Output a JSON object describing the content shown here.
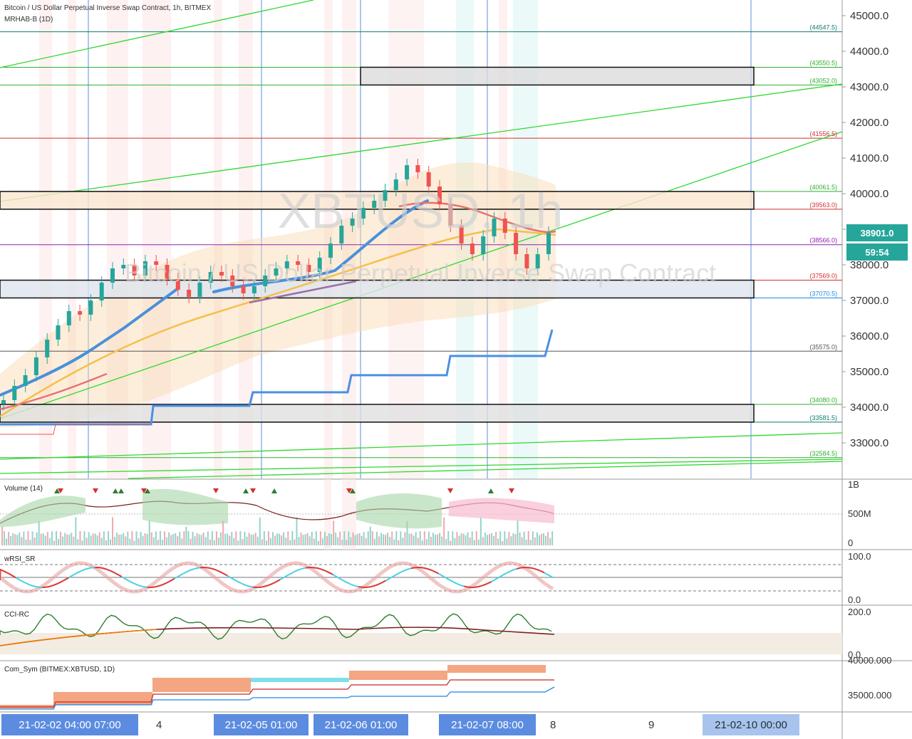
{
  "header": {
    "title": "Bitcoin / US Dollar Perpetual Inverse Swap Contract, 1h, BITMEX",
    "indicator": "MRHAB-B (1D)"
  },
  "watermark": {
    "symbol": "XBTUSD, 1h",
    "description": "Bitcoin / US Dollar Perpetual Inverse Swap Contract"
  },
  "price_axis": {
    "ticks": [
      "45000.0",
      "44000.0",
      "43000.0",
      "42000.0",
      "41000.0",
      "40000.0",
      "39000.0",
      "38000.0",
      "37000.0",
      "36000.0",
      "35000.0",
      "34000.0",
      "33000.0"
    ],
    "last_price": "38901.0",
    "countdown": "59:54",
    "last_price_color": "#26a69a"
  },
  "level_labels": [
    {
      "text": "(44547.5)",
      "color": "#137a6e"
    },
    {
      "text": "(43550.5)",
      "color": "#2fae2f"
    },
    {
      "text": "(43052.0)",
      "color": "#2fae2f"
    },
    {
      "text": "(41556.5)",
      "color": "#d12f2f"
    },
    {
      "text": "(40061.5)",
      "color": "#2fae2f"
    },
    {
      "text": "(39563.0)",
      "color": "#d12f2f"
    },
    {
      "text": "(38566.0)",
      "color": "#8e24aa"
    },
    {
      "text": "(37569.0)",
      "color": "#d12f2f"
    },
    {
      "text": "(37070.5)",
      "color": "#1e88e5"
    },
    {
      "text": "(35575.0)",
      "color": "#555555"
    },
    {
      "text": "(34080.0)",
      "color": "#2fae2f"
    },
    {
      "text": "(33581.5)",
      "color": "#137a6e"
    },
    {
      "text": "(32584.5)",
      "color": "#2fae2f"
    }
  ],
  "panels": {
    "volume": {
      "label": "Volume (14)",
      "ticks": [
        "1B",
        "500M",
        "0"
      ]
    },
    "rsi": {
      "label": "wRSI_SR",
      "ticks": [
        "100.0",
        "0.0"
      ]
    },
    "cci": {
      "label": "CCI-RC",
      "ticks": [
        "200.0",
        "0.0"
      ]
    },
    "comsym": {
      "label": "Com_Sym (BITMEX:XBTUSD, 1D)",
      "ticks": [
        "40000.000",
        "35000.000"
      ]
    }
  },
  "time_axis": {
    "tags": [
      "21-02-02   04:00   07:00",
      "21-02-05   01:00",
      "21-02-06   01:00",
      "21-02-07   08:00",
      "21-02-10   00:00"
    ],
    "ticks": [
      "4",
      "8",
      "9"
    ]
  },
  "chart_data": {
    "type": "line",
    "title": "Bitcoin / US Dollar Perpetual Inverse Swap Contract, 1h, BITMEX",
    "ylim": [
      32000,
      45500
    ],
    "close_series": [
      34200,
      34600,
      34900,
      35400,
      35900,
      36300,
      36700,
      36600,
      37000,
      37500,
      37900,
      38000,
      37700,
      38100,
      38000,
      37600,
      37300,
      37100,
      37500,
      37800,
      37700,
      37400,
      37200,
      37400,
      37700,
      37900,
      38100,
      38000,
      37800,
      38200,
      38600,
      39100,
      39300,
      39600,
      39800,
      40100,
      40400,
      40800,
      40600,
      40200,
      39700,
      39100,
      38600,
      38300,
      38800,
      39300,
      38900,
      38300,
      37900,
      38300,
      38901
    ],
    "levels": [
      44547.5,
      43550.5,
      43052.0,
      41556.5,
      40061.5,
      39563.0,
      38566.0,
      37569.0,
      37070.5,
      35575.0,
      34080.0,
      33581.5,
      32584.5
    ],
    "last_price": 38901.0
  }
}
